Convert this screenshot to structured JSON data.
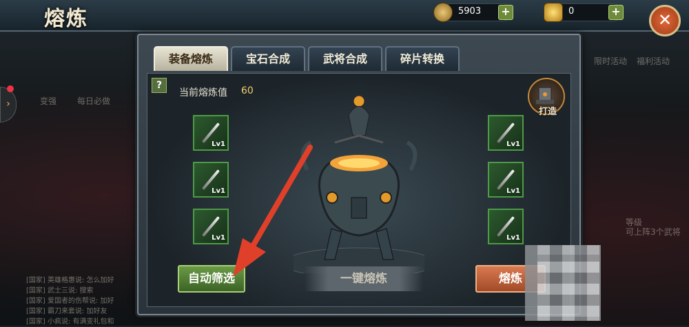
{
  "header": {
    "title": "熔炼",
    "coins": "5903",
    "ingots": "0",
    "plus": "+",
    "close": "✕"
  },
  "side": {
    "arrow": "›"
  },
  "background": {
    "labels": [
      "变强",
      "每日必做",
      "限时活动",
      "福利活动",
      "等级",
      "可上阵3个武将"
    ],
    "chat": [
      "[国家] 英雄格惠说: 怎么加好",
      "[国家] 武士三说: 搜索",
      "[国家] 爱国者的伤帮说: 加好",
      "[国家] 霸刀来套说: 加好友",
      "[国家] 小疯说: 有满变礼包和"
    ]
  },
  "tabs": [
    {
      "label": "装备熔炼",
      "active": true
    },
    {
      "label": "宝石合成",
      "active": false
    },
    {
      "label": "武将合成",
      "active": false
    },
    {
      "label": "碎片转换",
      "active": false
    }
  ],
  "main": {
    "help": "?",
    "smelt_label": "当前熔炼值",
    "smelt_value": "60",
    "forge_label": "打造",
    "slots": [
      "Lv1",
      "Lv1",
      "Lv1",
      "Lv1",
      "Lv1",
      "Lv1"
    ],
    "auto_button": "自动筛选",
    "oneclick_button": "一键熔炼",
    "smelt_button": "熔炼"
  },
  "colors": {
    "accent_green": "#4e9a48",
    "accent_orange": "#d87a50",
    "arrow_red": "#e0402a"
  }
}
